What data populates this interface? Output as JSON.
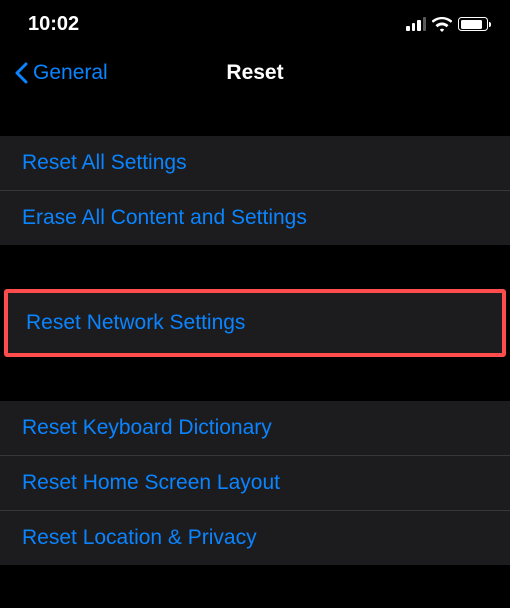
{
  "statusBar": {
    "time": "10:02"
  },
  "navBar": {
    "backLabel": "General",
    "title": "Reset"
  },
  "sections": {
    "group1": {
      "item0": "Reset All Settings",
      "item1": "Erase All Content and Settings"
    },
    "highlighted": {
      "item0": "Reset Network Settings"
    },
    "group2": {
      "item0": "Reset Keyboard Dictionary",
      "item1": "Reset Home Screen Layout",
      "item2": "Reset Location & Privacy"
    }
  },
  "colors": {
    "accent": "#0a84ff",
    "highlight": "#ff4c4c",
    "background": "#000000",
    "cell": "#1c1c1e"
  }
}
